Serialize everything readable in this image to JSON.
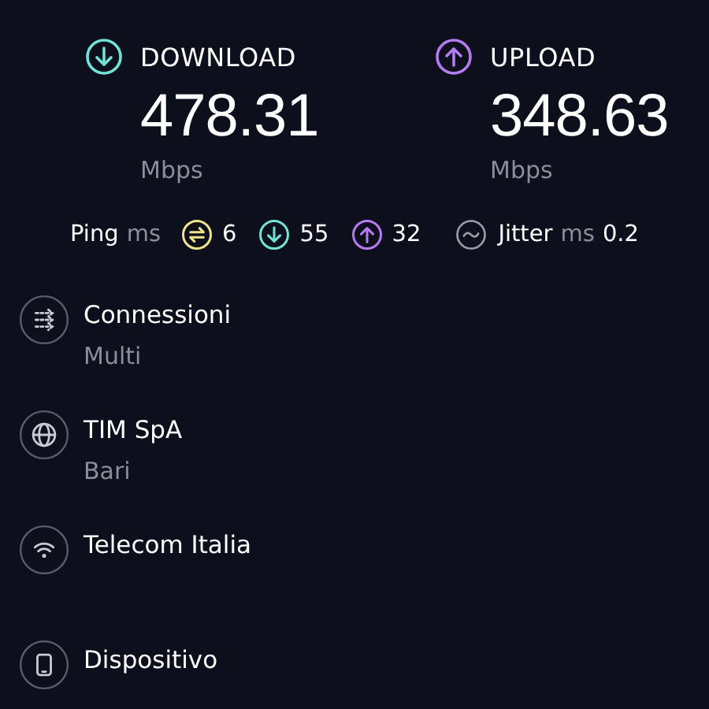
{
  "results": [
    {
      "kind": "download",
      "label": "DOWNLOAD",
      "value": "478.31",
      "unit": "Mbps"
    },
    {
      "kind": "upload",
      "label": "UPLOAD",
      "value": "348.63",
      "unit": "Mbps"
    }
  ],
  "latency": {
    "label": "Ping",
    "unit": "ms",
    "values": [
      {
        "kind": "idle",
        "value": "6"
      },
      {
        "kind": "download",
        "value": "55"
      },
      {
        "kind": "upload",
        "value": "32"
      }
    ]
  },
  "jitter": {
    "label": "Jitter",
    "unit": "ms",
    "value": "0.2"
  },
  "details": [
    {
      "kind": "connections",
      "title": "Connessioni",
      "subtitle": "Multi"
    },
    {
      "kind": "server",
      "title": "TIM SpA",
      "subtitle": "Bari"
    },
    {
      "kind": "network",
      "title": "Telecom Italia"
    },
    {
      "kind": "device",
      "title": "Dispositivo"
    }
  ]
}
